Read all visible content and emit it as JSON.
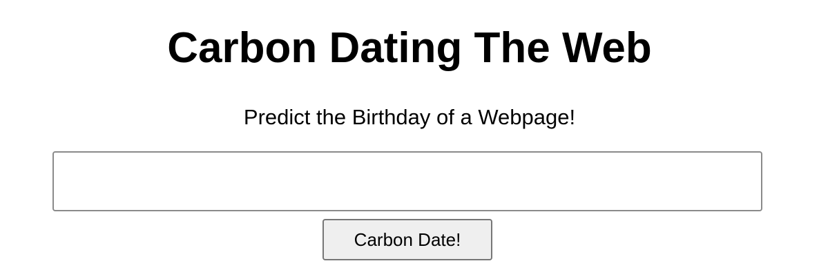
{
  "header": {
    "title": "Carbon Dating The Web",
    "subtitle": "Predict the Birthday of a Webpage!"
  },
  "form": {
    "url_input": {
      "value": "",
      "placeholder": ""
    },
    "submit_label": "Carbon Date!"
  },
  "colors": {
    "background": "#ffffff",
    "text": "#000000",
    "input_border": "#8a8a8a",
    "button_background": "#efefef",
    "button_border": "#767676"
  }
}
